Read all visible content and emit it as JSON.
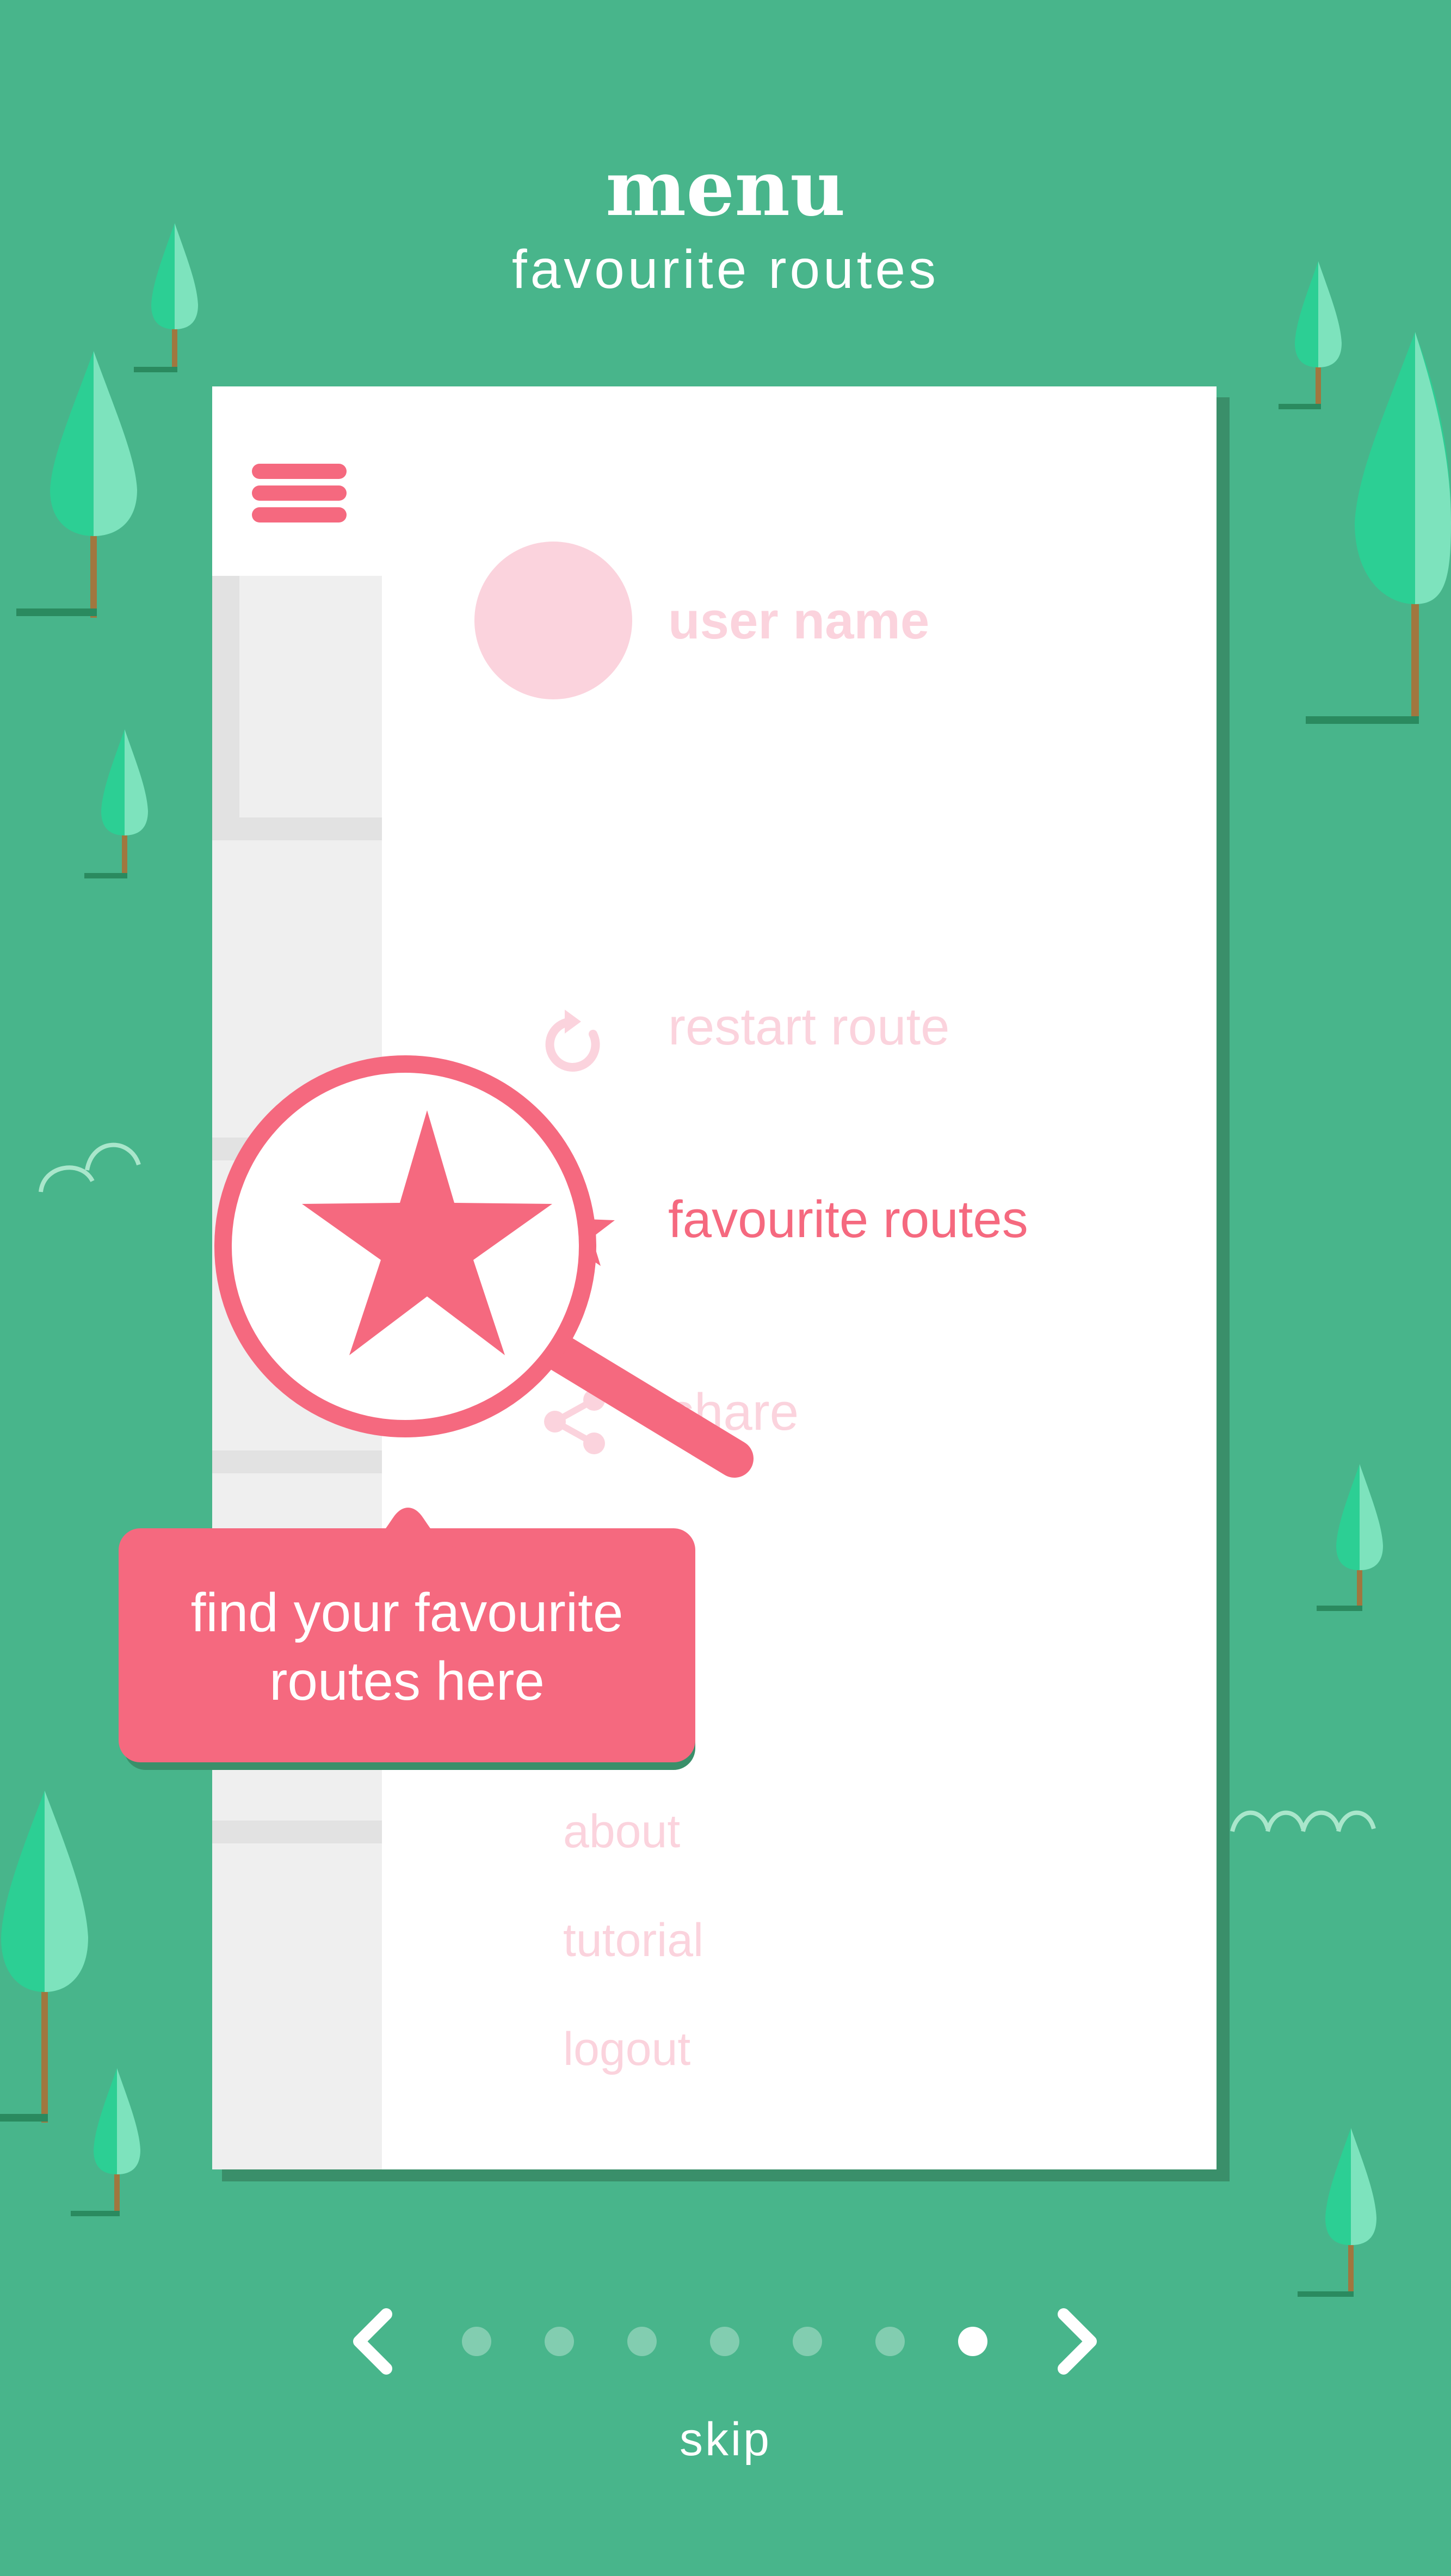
{
  "header": {
    "title": "menu",
    "subtitle": "favourite routes"
  },
  "drawer": {
    "user_name": "user name",
    "items": [
      {
        "label": "restart route",
        "icon": "restart-icon",
        "state": "faded"
      },
      {
        "label": "favourite routes",
        "icon": "star-icon",
        "state": "active"
      },
      {
        "label": "share",
        "icon": "share-icon",
        "state": "faded"
      }
    ],
    "secondary_items": [
      "about",
      "tutorial",
      "logout"
    ]
  },
  "tooltip": {
    "line1": "find your favourite",
    "line2": "routes here"
  },
  "pager": {
    "total_pages": 7,
    "current_page": 7,
    "skip_label": "skip"
  },
  "colors": {
    "background": "#48b58b",
    "accent": "#f5697f",
    "accent_faded": "#fbd3dd",
    "tree_dark": "#2ccf94",
    "tree_light": "#7de3bd",
    "tree_trunk": "#a0773f",
    "shadow": "#3a8f6a"
  }
}
